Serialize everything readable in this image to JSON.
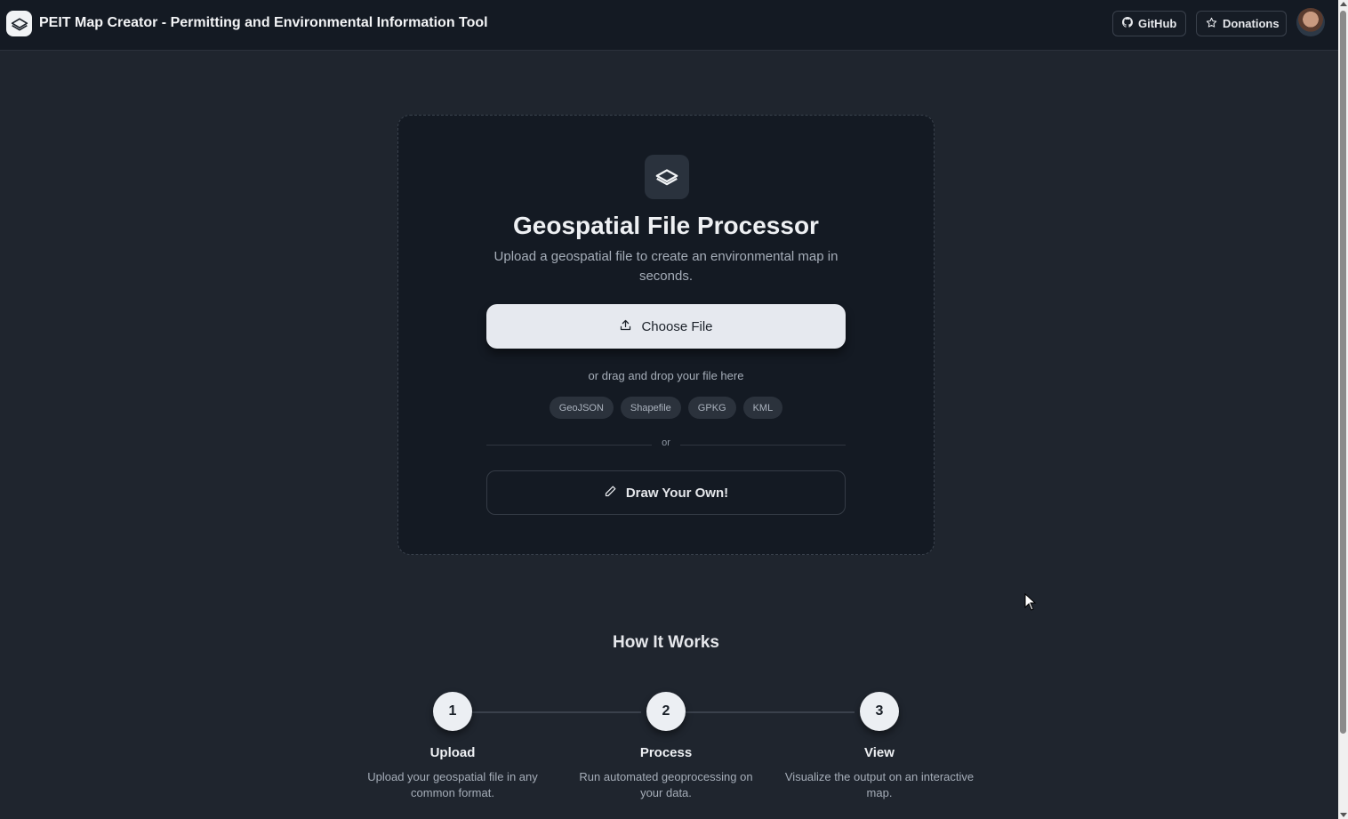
{
  "header": {
    "title": "PEIT Map Creator - Permitting and Environmental Information Tool",
    "github_label": "GitHub",
    "donations_label": "Donations"
  },
  "upload_card": {
    "title": "Geospatial File Processor",
    "subtitle": "Upload a geospatial file to create an environmental map in seconds.",
    "choose_file_label": "Choose File",
    "drag_text": "or drag and drop your file here",
    "formats": [
      "GeoJSON",
      "Shapefile",
      "GPKG",
      "KML"
    ],
    "divider_text": "or",
    "draw_label": "Draw Your Own!"
  },
  "how_it_works": {
    "title": "How It Works",
    "steps": [
      {
        "number": "1",
        "label": "Upload",
        "description": "Upload your geospatial file in any common format."
      },
      {
        "number": "2",
        "label": "Process",
        "description": "Run automated geoprocessing on your data."
      },
      {
        "number": "3",
        "label": "View",
        "description": "Visualize the output on an interactive map."
      }
    ]
  },
  "icons": {
    "logo": "layers-icon",
    "github": "github-icon",
    "donations": "star-icon",
    "upload": "upload-icon",
    "draw": "pencil-icon"
  },
  "colors": {
    "background": "#1f252e",
    "header": "#141a23",
    "card": "#141a23",
    "primary_button": "#e6e9ef"
  }
}
